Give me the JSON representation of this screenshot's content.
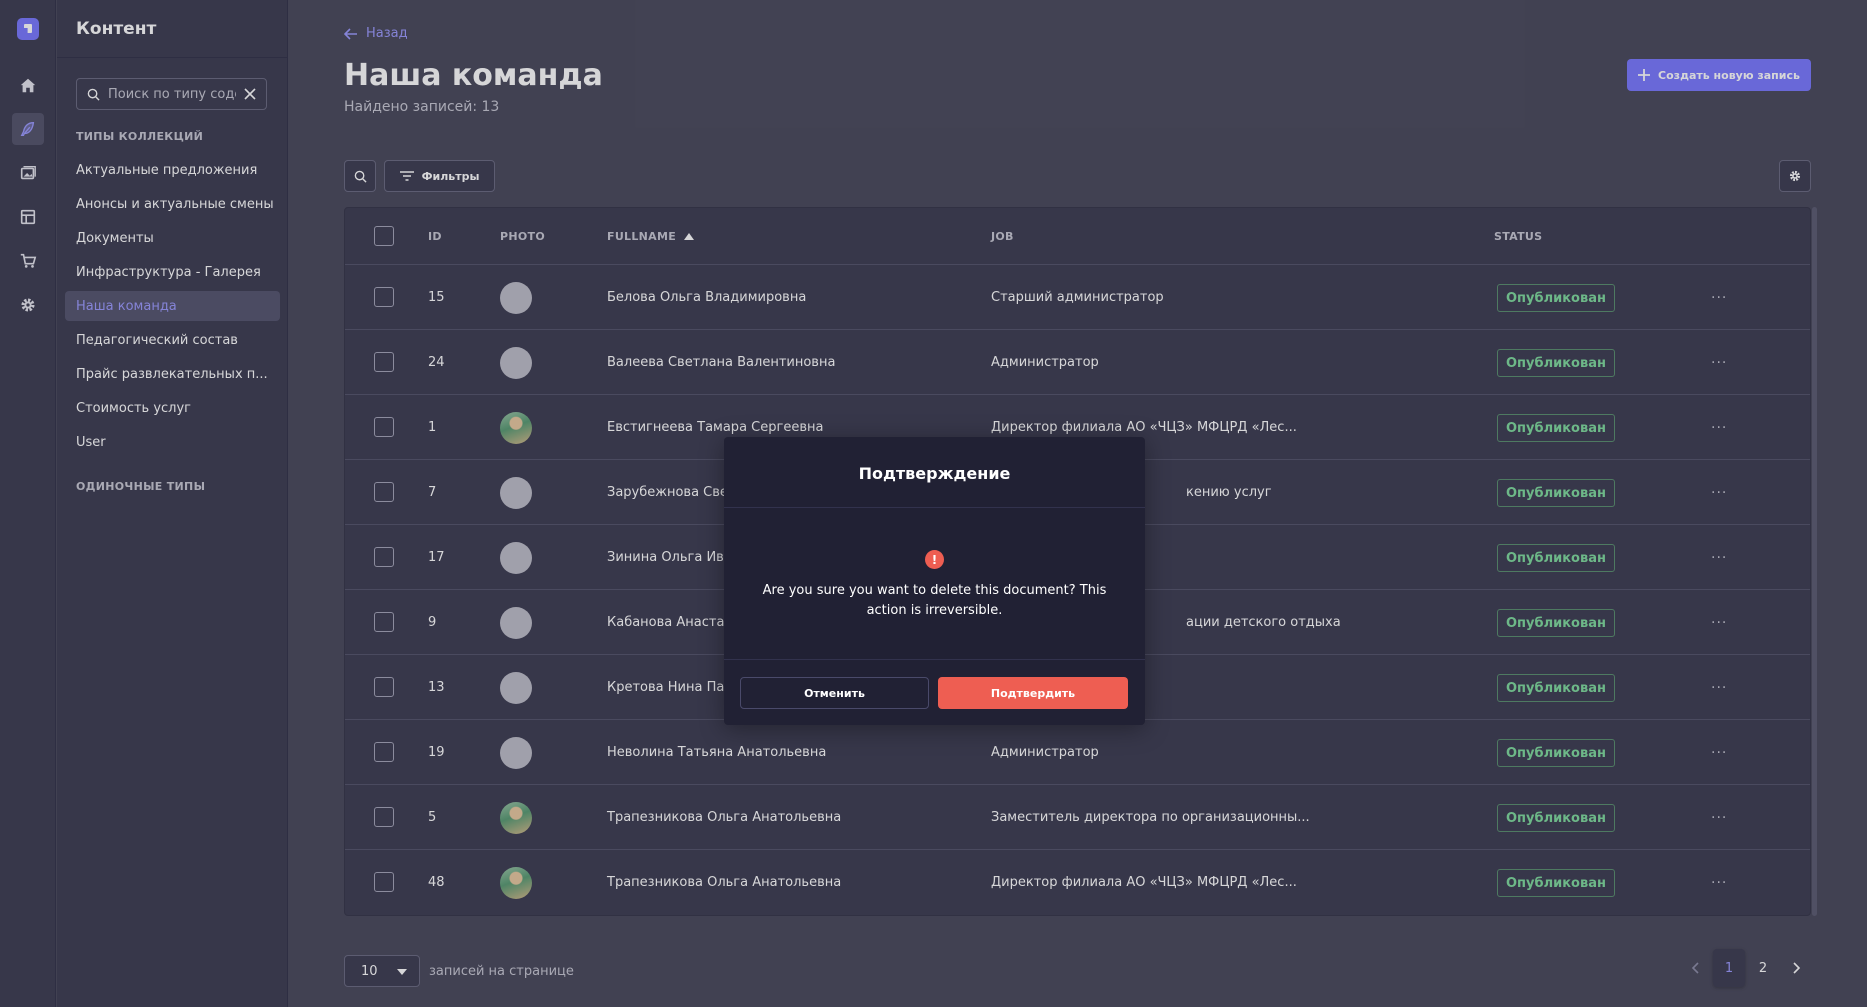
{
  "sidebar": {
    "title": "Контент",
    "search_placeholder": "Поиск по типу содержимого",
    "collection_types_header": "ТИПЫ КОЛЛЕКЦИЙ",
    "collection_types": [
      {
        "label": "Актуальные предложения"
      },
      {
        "label": "Анонсы и актуальные смены"
      },
      {
        "label": "Документы"
      },
      {
        "label": "Инфраструктура - Галерея"
      },
      {
        "label": "Наша команда",
        "active": true
      },
      {
        "label": "Педагогический состав"
      },
      {
        "label": "Прайс развлекательных п..."
      },
      {
        "label": "Стоимость услуг"
      },
      {
        "label": "User"
      }
    ],
    "single_types_header": "ОДИНОЧНЫЕ ТИПЫ"
  },
  "rail_icons": [
    "logo-icon",
    "home-icon",
    "feather-icon",
    "media-library-icon",
    "layout-icon",
    "cart-icon",
    "settings-icon"
  ],
  "header": {
    "back_label": "Назад",
    "title": "Наша команда",
    "subtitle": "Найдено записей: 13",
    "create_label": "Создать новую запись"
  },
  "toolbar": {
    "filters_label": "Фильтры"
  },
  "table": {
    "columns": {
      "id": "ID",
      "photo": "PHOTO",
      "fullname": "FULLNAME",
      "job": "JOB",
      "status": "STATUS"
    },
    "rows": [
      {
        "id": "15",
        "fullname": "Белова Ольга Владимировна",
        "job": "Старший администратор",
        "status": "Опубликован",
        "photo": "placeholder"
      },
      {
        "id": "24",
        "fullname": "Валеева Светлана Валентиновна",
        "job": "Администратор",
        "status": "Опубликован",
        "photo": "placeholder"
      },
      {
        "id": "1",
        "fullname": "Евстигнеева Тамара Сергеевна",
        "job": "Директор филиала АО «ЧЦЗ» МФЦРД «Лес...",
        "status": "Опубликован",
        "photo": "image"
      },
      {
        "id": "7",
        "fullname": "Зарубежнова Свет",
        "job": "кению услуг",
        "status": "Опубликован",
        "photo": "placeholder"
      },
      {
        "id": "17",
        "fullname": "Зинина Ольга Ива",
        "job": "",
        "status": "Опубликован",
        "photo": "placeholder"
      },
      {
        "id": "9",
        "fullname": "Кабанова Анастас",
        "job": "ации детского отдыха",
        "status": "Опубликован",
        "photo": "placeholder"
      },
      {
        "id": "13",
        "fullname": "Кретова Нина Пав",
        "job": "",
        "status": "Опубликован",
        "photo": "placeholder"
      },
      {
        "id": "19",
        "fullname": "Неволина Татьяна Анатольевна",
        "job": "Администратор",
        "status": "Опубликован",
        "photo": "placeholder"
      },
      {
        "id": "5",
        "fullname": "Трапезникова Ольга Анатольевна",
        "job": "Заместитель директора по организационны...",
        "status": "Опубликован",
        "photo": "image"
      },
      {
        "id": "48",
        "fullname": "Трапезникова Ольга Анатольевна",
        "job": "Директор филиала АО «ЧЦЗ» МФЦРД «Лес...",
        "status": "Опубликован",
        "photo": "image"
      }
    ],
    "more_label": "···"
  },
  "pagination": {
    "per_page_value": "10",
    "per_page_label": "записей на странице",
    "pages": [
      "1",
      "2"
    ],
    "current_page": "1"
  },
  "dialog": {
    "title": "Подтверждение",
    "message": "Are you sure you want to delete this document? This action is irreversible.",
    "cancel_label": "Отменить",
    "confirm_label": "Подтвердить",
    "warning_glyph": "!"
  },
  "colors": {
    "accent": "#7b79ff",
    "danger": "#ee5e52",
    "success_text": "#7fdb9e",
    "background": "#4a4a5c",
    "panel": "#3e3e52",
    "dialog": "#212134"
  }
}
